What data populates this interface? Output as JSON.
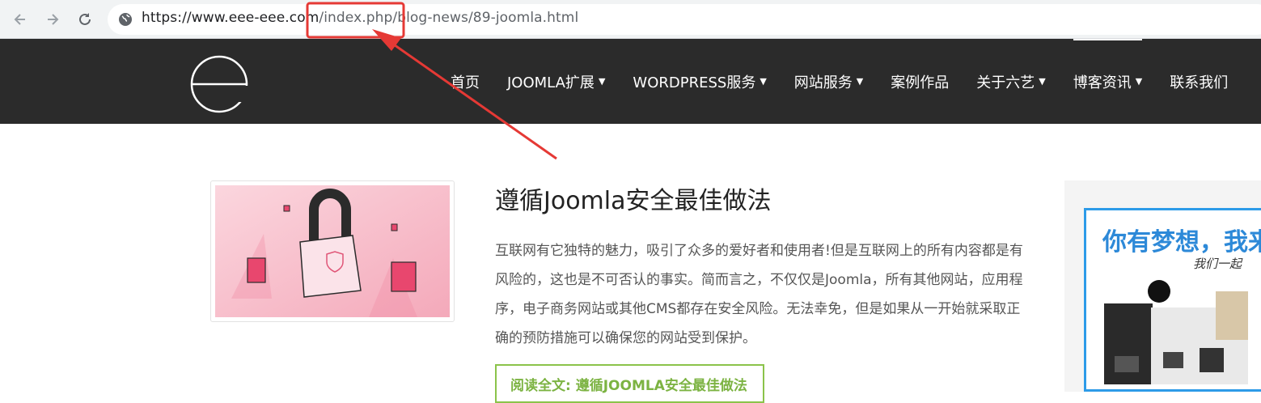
{
  "browser": {
    "url_host": "https://www.eee-eee.com",
    "url_path": "/index.php/blog-news/89-joomla.html"
  },
  "header": {
    "menu": [
      {
        "label": "首页",
        "caret": ""
      },
      {
        "label": "JOOMLA扩展",
        "caret": "▼"
      },
      {
        "label": "WORDPRESS服务",
        "caret": "▼"
      },
      {
        "label": "网站服务",
        "caret": "▼"
      },
      {
        "label": "案例作品",
        "caret": ""
      },
      {
        "label": "关于六艺",
        "caret": "▼"
      },
      {
        "label": "博客资讯",
        "caret": "▼"
      },
      {
        "label": "联系我们",
        "caret": ""
      }
    ]
  },
  "article": {
    "title": "遵循Joomla安全最佳做法",
    "body": "互联网有它独特的魅力，吸引了众多的爱好者和使用者!但是互联网上的所有内容都是有风险的，这也是不可否认的事实。简而言之，不仅仅是Joomla，所有其他网站，应用程序，电子商务网站或其他CMS都存在安全风险。无法幸免，但是如果从一开始就采取正确的预防措施可以确保您的网站受到保护。",
    "read_more": "阅读全文: 遵循JOOMLA安全最佳做法"
  },
  "sidebar": {
    "ad_headline": "你有梦想，我来",
    "ad_sub": "我们一起"
  },
  "colors": {
    "header_bg": "#2b2b2b",
    "accent_green": "#7cb342",
    "annotation_red": "#e53935",
    "ad_blue": "#2d9be8"
  }
}
